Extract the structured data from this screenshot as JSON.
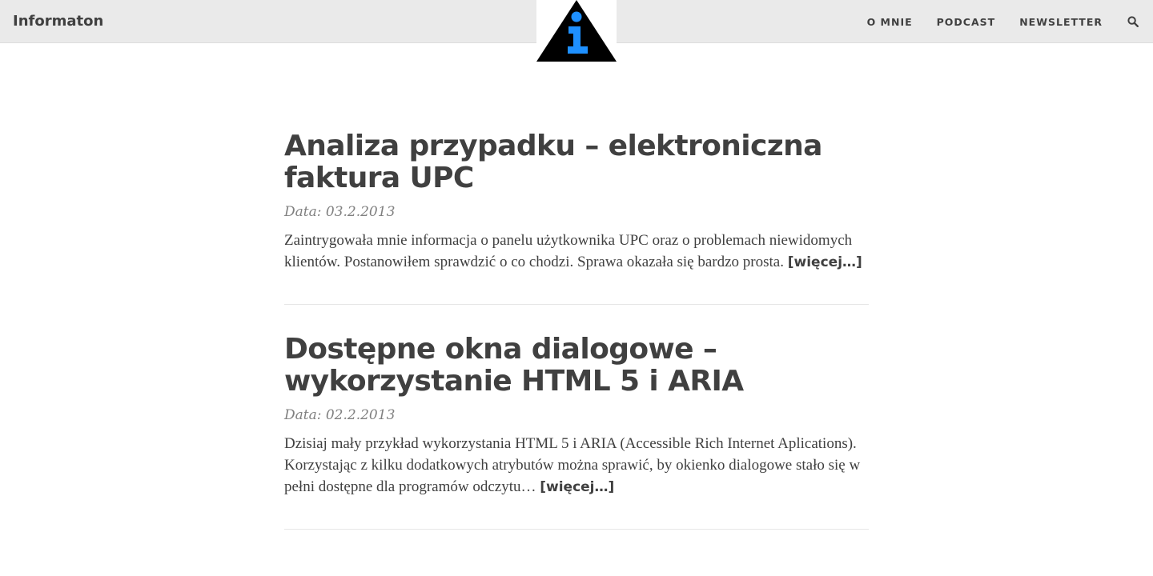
{
  "brand": {
    "title": "Informaton"
  },
  "logo": {
    "icon": "info-triangle-logo",
    "colors": {
      "triangle": "#000000",
      "glyph": "#1e90ff"
    }
  },
  "nav": {
    "items": [
      {
        "label": "O MNIE"
      },
      {
        "label": "PODCAST"
      },
      {
        "label": "NEWSLETTER"
      }
    ],
    "search_icon": "search-icon"
  },
  "posts": [
    {
      "title": "Analiza przypadku – elektroniczna faktura UPC",
      "date": "Data: 03.2.2013",
      "excerpt": "Zaintrygowała mnie informacja o panelu użytkownika UPC oraz o problemach niewidomych klientów. Postanowiłem sprawdzić o co chodzi. Sprawa okazała się bardzo prosta.",
      "more": "[więcej…]"
    },
    {
      "title": "Dostępne okna dialogowe – wykorzystanie HTML 5 i ARIA",
      "date": "Data: 02.2.2013",
      "excerpt": "Dzisiaj mały przykład wykorzystania HTML 5 i ARIA (Accessible Rich Internet Aplications). Korzystając z kilku dodatkowych atrybutów można sprawić, by okienko dialogowe stało się w pełni dostępne dla programów odczytu…",
      "more": "[więcej…]"
    }
  ]
}
